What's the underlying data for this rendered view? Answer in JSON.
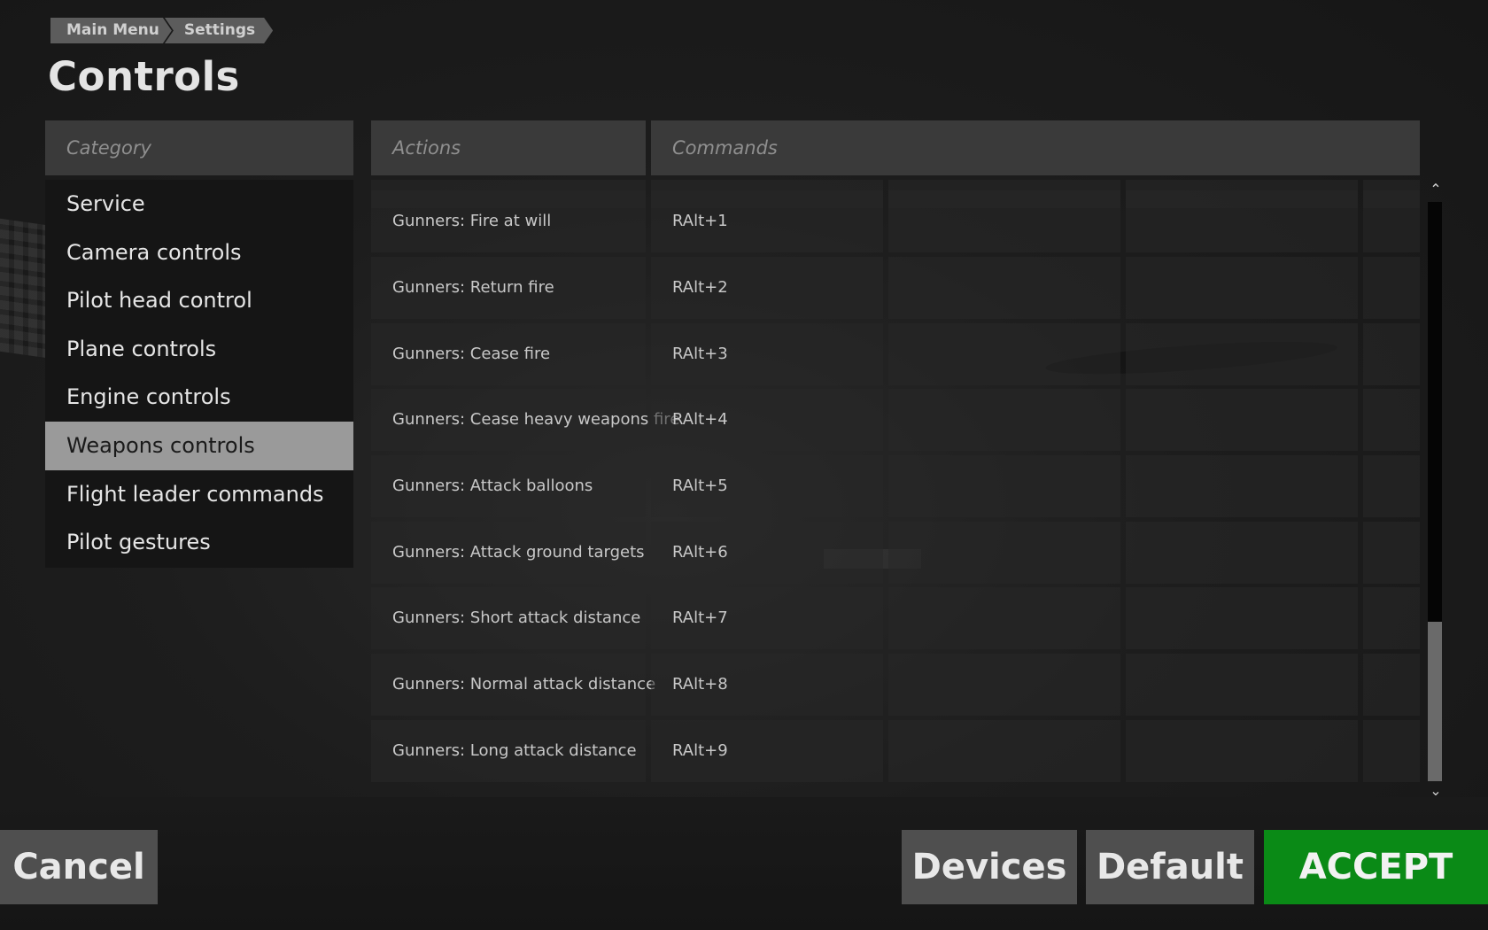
{
  "breadcrumb": [
    "Main Menu",
    "Settings"
  ],
  "page_title": "Controls",
  "headers": {
    "category": "Category",
    "actions": "Actions",
    "commands": "Commands"
  },
  "categories": [
    "Service",
    "Camera controls",
    "Pilot head control",
    "Plane controls",
    "Engine controls",
    "Weapons controls",
    "Flight leader commands",
    "Pilot gestures"
  ],
  "selected_category": "Weapons controls",
  "rows": [
    {
      "action": "",
      "command": ""
    },
    {
      "action": "Gunners: Fire at will",
      "command": "RAlt+1"
    },
    {
      "action": "Gunners: Return fire",
      "command": "RAlt+2"
    },
    {
      "action": "Gunners: Cease fire",
      "command": "RAlt+3"
    },
    {
      "action": "Gunners: Cease heavy weapons fire",
      "command": "RAlt+4"
    },
    {
      "action": "Gunners: Attack balloons",
      "command": "RAlt+5"
    },
    {
      "action": "Gunners: Attack ground targets",
      "command": "RAlt+6"
    },
    {
      "action": "Gunners: Short attack distance",
      "command": "RAlt+7"
    },
    {
      "action": "Gunners: Normal attack distance",
      "command": "RAlt+8"
    },
    {
      "action": "Gunners: Long attack distance",
      "command": "RAlt+9"
    }
  ],
  "scroll_position_fraction": 0.72,
  "buttons": {
    "cancel": "Cancel",
    "devices": "Devices",
    "default": "Default",
    "accept": "ACCEPT"
  },
  "colors": {
    "accent_accept": "#0a8a16",
    "selected_item": "#9a9a9a"
  },
  "icons": {
    "scroll_up": "chevron-up-icon",
    "scroll_down": "chevron-down-icon"
  }
}
